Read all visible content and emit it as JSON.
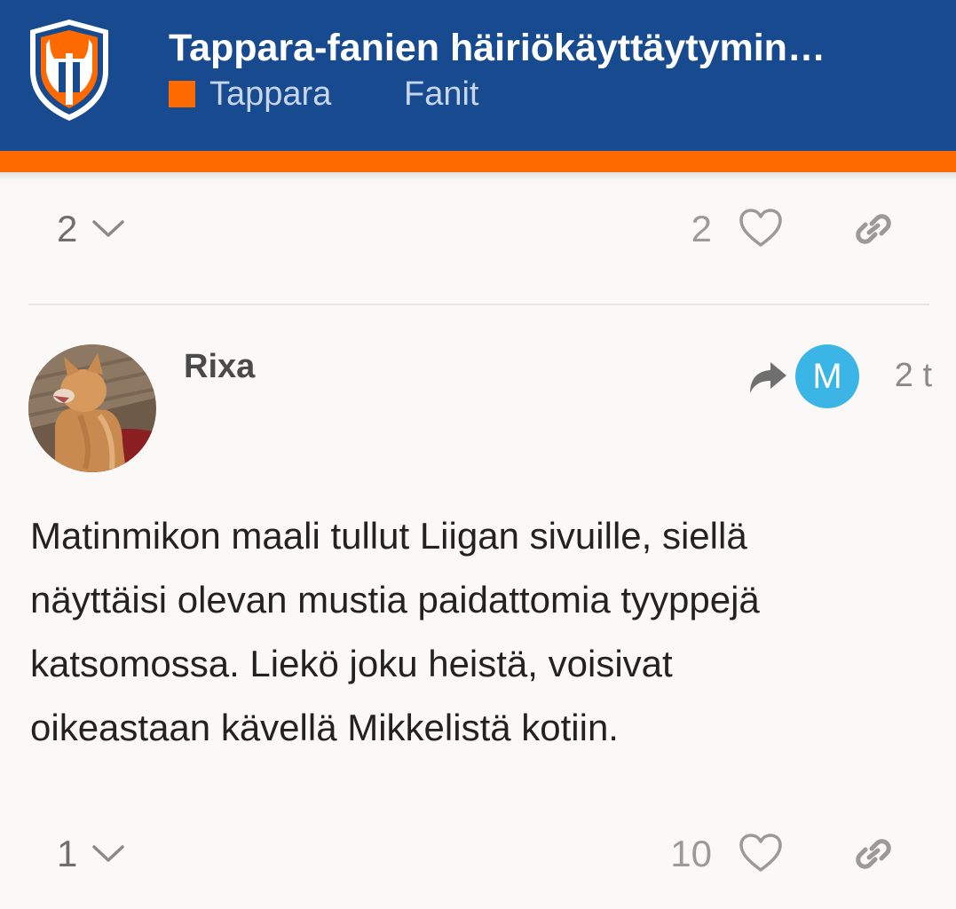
{
  "header": {
    "title": "Tappara-fanien häiriökäyttäytymin…",
    "categories": [
      {
        "label": "Tappara",
        "color": "#ff6a00"
      },
      {
        "label": "Fanit"
      }
    ],
    "colors": {
      "bar": "#174a8f",
      "accent": "#ff6a00"
    },
    "logo_icon": "tappara-shield-logo"
  },
  "previous_post": {
    "replies_count": "2",
    "likes_count": "2"
  },
  "post": {
    "username": "Rixa",
    "reply_to_avatar_letter": "M",
    "reply_to_avatar_color": "#3ab5e6",
    "date": "2 t",
    "body_lines": [
      "Matinmikon maali tullut Liigan sivuille, siellä",
      "näyttäisi olevan mustia paidattomia tyyppejä",
      "katsomossa. Liekö joku heistä, voisivat",
      "oikeastaan kävellä Mikkelistä kotiin."
    ],
    "replies_count": "1",
    "likes_count": "10"
  },
  "icons": [
    "chevron-down-icon",
    "heart-icon",
    "link-icon",
    "reply-arrow-icon"
  ]
}
